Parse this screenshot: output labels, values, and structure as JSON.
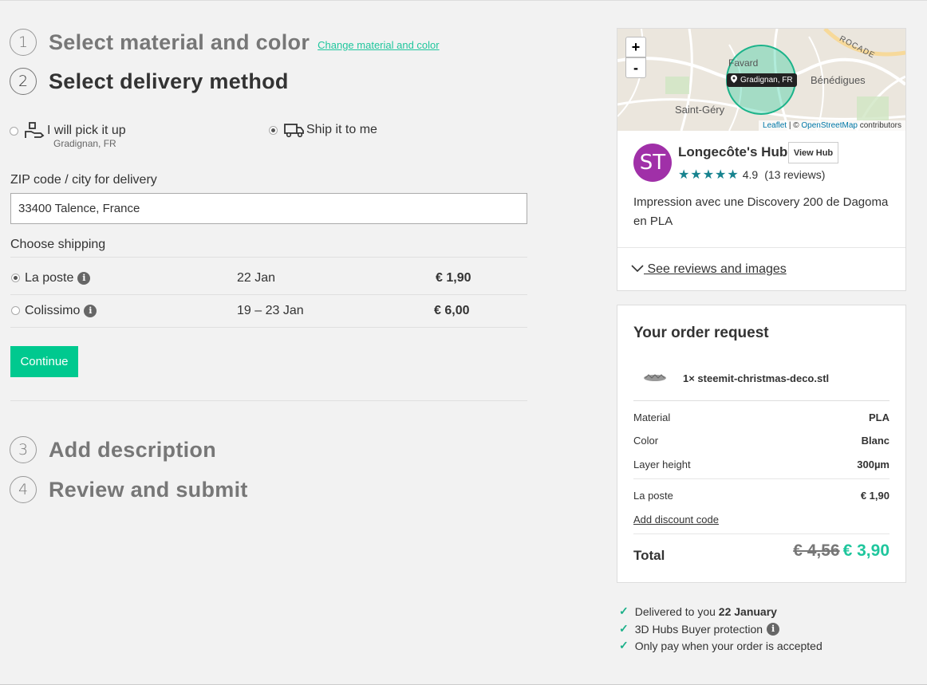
{
  "steps": [
    {
      "num": "1",
      "title": "Select material and color",
      "link": "Change material and color"
    },
    {
      "num": "2",
      "title": "Select delivery method"
    },
    {
      "num": "3",
      "title": "Add description"
    },
    {
      "num": "4",
      "title": "Review and submit"
    }
  ],
  "delivery": {
    "pickup_label": "I will pick it up",
    "pickup_location": "Gradignan, FR",
    "ship_label": "Ship it to me",
    "selected": "ship"
  },
  "zip": {
    "label": "ZIP code / city for delivery",
    "value": "33400 Talence, France"
  },
  "shipping": {
    "label": "Choose shipping",
    "options": [
      {
        "name": "La poste",
        "date": "22 Jan",
        "price": "€ 1,90",
        "selected": true
      },
      {
        "name": "Colissimo",
        "date": "19 – 23 Jan",
        "price": "€ 6,00",
        "selected": false
      }
    ]
  },
  "continue_label": "Continue",
  "map": {
    "zoom_in": "+",
    "zoom_out": "-",
    "pin_label": "Gradignan, FR",
    "places": [
      "Favard",
      "Bénédigues",
      "Saint-Géry",
      "ROCADE"
    ],
    "attr_leaflet": "Leaflet",
    "attr_sep": " | © ",
    "attr_osm": "OpenStreetMap",
    "attr_tail": " contributors"
  },
  "hub": {
    "initials": "ST",
    "avatar_color": "#a030a8",
    "name": "Longecôte's Hub",
    "view_hub": "View Hub",
    "rating": "4.9",
    "reviews": "(13 reviews)",
    "description": "Impression avec une Discovery 200 de Dagoma en PLA",
    "see_reviews": " See reviews and images"
  },
  "order": {
    "title": "Your order request",
    "item": "1× steemit-christmas-deco.stl",
    "rows": [
      {
        "label": "Material",
        "value": "PLA"
      },
      {
        "label": "Color",
        "value": "Blanc"
      },
      {
        "label": "Layer height",
        "value": "300µm"
      }
    ],
    "shipping_label": "La poste",
    "shipping_value": "€ 1,90",
    "discount_link": "Add discount code",
    "total_label": "Total",
    "old_total": "€ 4,56",
    "new_total": "€ 3,90"
  },
  "guarantees": {
    "delivered_prefix": "Delivered to you ",
    "delivered_date": "22 January",
    "protection": "3D Hubs Buyer protection",
    "pay": "Only pay when your order is accepted"
  },
  "colors": {
    "accent": "#00c98f",
    "teal_star": "#17838f"
  }
}
